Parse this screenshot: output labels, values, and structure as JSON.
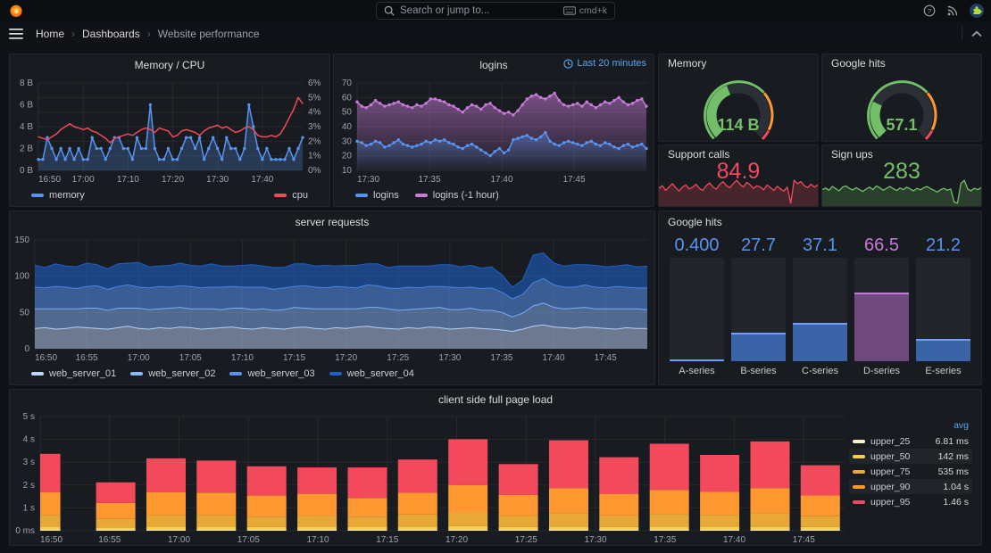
{
  "topnav": {
    "search_placeholder": "Search or jump to...",
    "shortcut": "cmd+k"
  },
  "breadcrumb": {
    "items": [
      "Home",
      "Dashboards",
      "Website performance"
    ],
    "separator": "›"
  },
  "colors": {
    "accent_blue": "#5794F2",
    "accent_red": "#F2495C",
    "accent_green": "#73BF69",
    "accent_purple": "#C77BD9",
    "accent_orange": "#FF9830",
    "link_blue": "#58A6F0",
    "panel_bg": "#181B1F",
    "page_bg": "#111217"
  },
  "panels": {
    "memory_cpu": {
      "title": "Memory / CPU"
    },
    "logins": {
      "title": "logins",
      "time_range": "Last 20 minutes"
    },
    "memory_gauge": {
      "title": "Memory"
    },
    "google_gauge": {
      "title": "Google hits"
    },
    "support_calls": {
      "title": "Support calls"
    },
    "sign_ups": {
      "title": "Sign ups"
    },
    "server_requests": {
      "title": "server requests"
    },
    "google_hits_bars": {
      "title": "Google hits"
    },
    "client_load": {
      "title": "client side full page load"
    }
  },
  "chart_data": [
    {
      "id": "memory_cpu",
      "type": "line",
      "title": "Memory / CPU",
      "x_ticks": [
        "16:50",
        "17:00",
        "17:10",
        "17:20",
        "17:30",
        "17:40"
      ],
      "x_step_frac": 0.1695,
      "y_left": {
        "min": 0,
        "max": 8,
        "ticks": [
          "8 B",
          "6 B",
          "4 B",
          "2 B",
          "0 B"
        ]
      },
      "y_right": {
        "min": 0,
        "max": 6,
        "ticks": [
          "6%",
          "5%",
          "4%",
          "3%",
          "2%",
          "1%",
          "0%"
        ]
      },
      "series": [
        {
          "name": "memory",
          "color": "#5794F2",
          "axis": "left",
          "markers": true,
          "fill_opacity": 0.25,
          "values": [
            1,
            1,
            3,
            2,
            1,
            2,
            1,
            2,
            1,
            2,
            1,
            1,
            3,
            2,
            2,
            1,
            2,
            3,
            3,
            2,
            2,
            1,
            3,
            2,
            2,
            6,
            2,
            1,
            1,
            2,
            1,
            1,
            2,
            3,
            3,
            2,
            3,
            1,
            2,
            3,
            2,
            1,
            3,
            2,
            2,
            1,
            2,
            6,
            4,
            2,
            1,
            2,
            1,
            1,
            1,
            1,
            2,
            1,
            2,
            3
          ]
        },
        {
          "name": "cpu",
          "color": "#F2495C",
          "axis": "right",
          "values": [
            2.3,
            2.2,
            2.1,
            2.3,
            2.5,
            2.8,
            3.0,
            3.2,
            3.0,
            2.9,
            2.8,
            2.9,
            2.7,
            2.6,
            2.4,
            2.2,
            1.9,
            2.2,
            2.3,
            2.4,
            2.5,
            2.4,
            2.6,
            2.8,
            2.9,
            2.8,
            2.6,
            2.9,
            2.8,
            2.7,
            2.3,
            2.4,
            2.7,
            2.8,
            2.7,
            2.6,
            2.4,
            2.7,
            2.9,
            3.0,
            3.1,
            2.9,
            3.0,
            2.8,
            2.6,
            2.7,
            2.9,
            3.0,
            2.8,
            2.4,
            2.3,
            2.3,
            2.4,
            2.3,
            2.5,
            3.0,
            3.6,
            4.2,
            5.0,
            4.6
          ]
        }
      ]
    },
    {
      "id": "logins",
      "type": "line",
      "title": "logins",
      "time_range": "Last 20 minutes",
      "x_ticks": [
        "17:30",
        "17:35",
        "17:40",
        "17:45"
      ],
      "x_step_frac": 0.25,
      "y_left": {
        "min": 10,
        "max": 70,
        "ticks": [
          "70",
          "60",
          "50",
          "40",
          "30",
          "20",
          "10"
        ]
      },
      "series": [
        {
          "name": "logins (-1 hour)",
          "color": "#C77BD9",
          "markers": true,
          "fill_grad": [
            0.55,
            0.03
          ],
          "values": [
            57,
            54,
            53,
            55,
            58,
            56,
            54,
            55,
            56,
            57,
            55,
            54,
            53,
            55,
            54,
            56,
            59,
            59,
            58,
            57,
            55,
            54,
            52,
            50,
            53,
            55,
            54,
            52,
            55,
            56,
            53,
            51,
            49,
            50,
            48,
            51,
            55,
            59,
            61,
            62,
            60,
            59,
            61,
            63,
            58,
            55,
            54,
            55,
            56,
            54,
            57,
            55,
            53,
            55,
            57,
            56,
            58,
            60,
            57,
            55,
            56,
            58,
            59,
            54
          ]
        },
        {
          "name": "logins",
          "color": "#5794F2",
          "markers": true,
          "fill_grad": [
            0.4,
            0.03
          ],
          "values": [
            30,
            29,
            27,
            28,
            30,
            29,
            26,
            27,
            29,
            31,
            28,
            27,
            26,
            27,
            28,
            30,
            29,
            31,
            30,
            31,
            29,
            28,
            26,
            25,
            27,
            28,
            26,
            24,
            22,
            20,
            23,
            25,
            22,
            24,
            31,
            32,
            33,
            34,
            32,
            31,
            33,
            36,
            30,
            28,
            27,
            29,
            30,
            29,
            28,
            27,
            29,
            30,
            28,
            27,
            29,
            28,
            26,
            25,
            27,
            28,
            26,
            27,
            28,
            25
          ]
        }
      ],
      "legend_order": [
        "logins",
        "logins (-1 hour)"
      ]
    },
    {
      "id": "memory_gauge",
      "type": "gauge",
      "title": "Memory",
      "value": "114 B",
      "fraction": 0.42,
      "value_color": "#73BF69",
      "track_color": "#2b2f36",
      "thresholds": [
        {
          "to": 0.68,
          "color": "#73BF69"
        },
        {
          "to": 0.93,
          "color": "#FF9830"
        },
        {
          "to": 1.0,
          "color": "#F2495C"
        }
      ]
    },
    {
      "id": "google_gauge",
      "type": "gauge",
      "title": "Google hits",
      "value": "57.1",
      "fraction": 0.26,
      "value_color": "#73BF69",
      "track_color": "#2b2f36",
      "thresholds": [
        {
          "to": 0.68,
          "color": "#73BF69"
        },
        {
          "to": 0.93,
          "color": "#FF9830"
        },
        {
          "to": 1.0,
          "color": "#F2495C"
        }
      ]
    },
    {
      "id": "support_calls",
      "type": "sparkstat",
      "title": "Support calls",
      "value": "84.9",
      "color": "#F2495C",
      "values": [
        78,
        82,
        75,
        80,
        85,
        79,
        74,
        80,
        83,
        77,
        80,
        84,
        78,
        75,
        82,
        86,
        80,
        77,
        84,
        88,
        82,
        79,
        85,
        90,
        84,
        80,
        87,
        83,
        78,
        82,
        80,
        76,
        83,
        79,
        75,
        81,
        77,
        74,
        80,
        56,
        90,
        85,
        88,
        82,
        79,
        84,
        80,
        83
      ]
    },
    {
      "id": "sign_ups",
      "type": "sparkstat",
      "title": "Sign ups",
      "value": "283",
      "color": "#73BF69",
      "values": [
        280,
        285,
        278,
        290,
        283,
        276,
        288,
        292,
        284,
        279,
        286,
        280,
        274,
        282,
        288,
        280,
        292,
        286,
        278,
        284,
        290,
        283,
        277,
        285,
        280,
        288,
        282,
        276,
        284,
        279,
        286,
        290,
        283,
        278,
        272,
        280,
        284,
        278,
        282,
        240,
        236,
        300,
        310,
        282,
        276,
        284,
        280,
        286
      ]
    },
    {
      "id": "server_requests",
      "type": "stacked_area",
      "title": "server requests",
      "x_ticks": [
        "16:50",
        "16:55",
        "17:00",
        "17:05",
        "17:10",
        "17:15",
        "17:20",
        "17:25",
        "17:30",
        "17:35",
        "17:40",
        "17:45"
      ],
      "x_step_frac": 0.0847,
      "y_left": {
        "min": 0,
        "max": 150,
        "ticks": [
          "150",
          "100",
          "50",
          "0"
        ]
      },
      "series": [
        {
          "name": "web_server_01",
          "color": "#C0D8FF",
          "fill_opacity": 0.5,
          "values": [
            28,
            29,
            27,
            28,
            30,
            29,
            28,
            27,
            29,
            31,
            28,
            27,
            29,
            28,
            30,
            29,
            27,
            28,
            29,
            30,
            28,
            27,
            29,
            28,
            27,
            29,
            30,
            28,
            27,
            29,
            28,
            30,
            31,
            29,
            28,
            27,
            29,
            28,
            30,
            29,
            27,
            28,
            29,
            28,
            27,
            26,
            24,
            27,
            31,
            33,
            30,
            29,
            28,
            30,
            29,
            28,
            27,
            29,
            28,
            28
          ]
        },
        {
          "name": "web_server_02",
          "color": "#8AB8FF",
          "fill_opacity": 0.5,
          "values": [
            27,
            26,
            28,
            27,
            25,
            27,
            28,
            26,
            27,
            25,
            28,
            27,
            26,
            28,
            27,
            26,
            28,
            27,
            25,
            26,
            28,
            27,
            26,
            25,
            27,
            28,
            26,
            27,
            28,
            26,
            27,
            25,
            26,
            28,
            27,
            26,
            25,
            27,
            26,
            28,
            27,
            26,
            27,
            25,
            26,
            24,
            20,
            22,
            28,
            30,
            27,
            26,
            28,
            27,
            26,
            27,
            28,
            26,
            27,
            26
          ]
        },
        {
          "name": "web_server_03",
          "color": "#5794F2",
          "fill_opacity": 0.55,
          "values": [
            30,
            29,
            31,
            30,
            28,
            30,
            31,
            29,
            30,
            32,
            29,
            30,
            31,
            29,
            30,
            31,
            29,
            30,
            31,
            30,
            29,
            31,
            30,
            29,
            30,
            29,
            31,
            30,
            29,
            31,
            30,
            29,
            31,
            30,
            29,
            30,
            31,
            29,
            30,
            29,
            31,
            30,
            29,
            30,
            31,
            28,
            25,
            26,
            32,
            34,
            31,
            30,
            29,
            31,
            30,
            29,
            31,
            30,
            29,
            30
          ]
        },
        {
          "name": "web_server_04",
          "color": "#1F60C4",
          "fill_opacity": 0.6,
          "values": [
            30,
            28,
            31,
            29,
            30,
            32,
            29,
            28,
            31,
            30,
            34,
            29,
            28,
            30,
            31,
            29,
            30,
            32,
            29,
            28,
            30,
            31,
            29,
            30,
            28,
            31,
            30,
            29,
            31,
            28,
            30,
            31,
            29,
            30,
            28,
            31,
            29,
            30,
            28,
            30,
            31,
            29,
            30,
            28,
            29,
            24,
            16,
            20,
            38,
            35,
            30,
            29,
            31,
            28,
            30,
            29,
            28,
            31,
            29,
            30
          ]
        }
      ]
    },
    {
      "id": "google_hits_bars",
      "type": "bargauge",
      "title": "Google hits",
      "max": 100,
      "categories": [
        "A-series",
        "B-series",
        "C-series",
        "D-series",
        "E-series"
      ],
      "values": [
        0.4,
        27.7,
        37.1,
        66.5,
        21.2
      ],
      "display_values": [
        "0.400",
        "27.7",
        "37.1",
        "66.5",
        "21.2"
      ],
      "value_colors": [
        "#5794F2",
        "#5794F2",
        "#5794F2",
        "#C77BD9",
        "#5794F2"
      ],
      "bar_colors": [
        "#3A63A8",
        "#3A63A8",
        "#3A63A8",
        "#70497F",
        "#3A63A8"
      ],
      "top_colors": [
        "#6E9FFF",
        "#6E9FFF",
        "#6E9FFF",
        "#C77BD9",
        "#6E9FFF"
      ]
    },
    {
      "id": "client_load",
      "type": "stacked_bars",
      "title": "client side full page load",
      "ymax": 5,
      "y_ticks": [
        "5 s",
        "4 s",
        "3 s",
        "2 s",
        "1 s",
        "0 ms"
      ],
      "x_ticks": [
        "16:50",
        "16:55",
        "17:00",
        "17:05",
        "17:10",
        "17:15",
        "17:20",
        "17:25",
        "17:30",
        "17:35",
        "17:40",
        "17:45"
      ],
      "x_step_frac": 0.0862,
      "legend_header": "avg",
      "series": [
        {
          "name": "upper_25",
          "color": "#FBF0CE",
          "avg": "6.81 ms"
        },
        {
          "name": "upper_50",
          "color": "#F7CE52",
          "avg": "142 ms"
        },
        {
          "name": "upper_75",
          "color": "#E8A838",
          "avg": "535 ms"
        },
        {
          "name": "upper_90",
          "color": "#FF9830",
          "avg": "1.04 s"
        },
        {
          "name": "upper_95",
          "color": "#F2495C",
          "avg": "1.46 s"
        }
      ],
      "bars": [
        [
          0.02,
          0.14,
          0.5,
          1.0,
          1.69
        ],
        [
          0.02,
          0.1,
          0.38,
          0.7,
          0.9
        ],
        [
          0.02,
          0.14,
          0.5,
          1.0,
          1.49
        ],
        [
          0.02,
          0.15,
          0.5,
          0.98,
          1.4
        ],
        [
          0.02,
          0.13,
          0.45,
          0.92,
          1.28
        ],
        [
          0.02,
          0.14,
          0.48,
          0.96,
          1.15
        ],
        [
          0.02,
          0.12,
          0.46,
          0.82,
          1.33
        ],
        [
          0.02,
          0.15,
          0.52,
          0.95,
          1.46
        ],
        [
          0.03,
          0.16,
          0.6,
          1.2,
          2.01
        ],
        [
          0.02,
          0.13,
          0.48,
          0.92,
          1.35
        ],
        [
          0.03,
          0.15,
          0.58,
          1.1,
          2.09
        ],
        [
          0.02,
          0.13,
          0.5,
          0.95,
          1.6
        ],
        [
          0.03,
          0.15,
          0.55,
          1.05,
          2.02
        ],
        [
          0.02,
          0.14,
          0.52,
          1.0,
          1.62
        ],
        [
          0.03,
          0.15,
          0.58,
          1.1,
          2.04
        ],
        [
          0.02,
          0.13,
          0.48,
          0.9,
          1.32
        ]
      ]
    }
  ]
}
